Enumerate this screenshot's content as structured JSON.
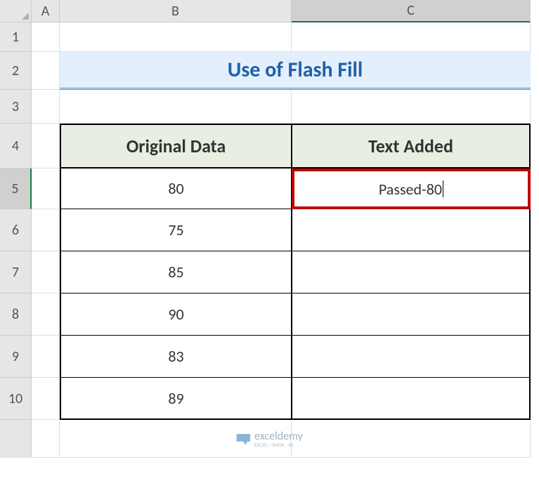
{
  "columns": {
    "A": "A",
    "B": "B",
    "C": "C"
  },
  "rows": [
    "1",
    "2",
    "3",
    "4",
    "5",
    "6",
    "7",
    "8",
    "9",
    "10"
  ],
  "title": "Use of Flash Fill",
  "headers": {
    "original": "Original Data",
    "added": "Text Added"
  },
  "data": [
    {
      "original": "80",
      "added": "Passed-80"
    },
    {
      "original": "75",
      "added": ""
    },
    {
      "original": "85",
      "added": ""
    },
    {
      "original": "90",
      "added": ""
    },
    {
      "original": "83",
      "added": ""
    },
    {
      "original": "89",
      "added": ""
    }
  ],
  "watermark": {
    "main": "exceldemy",
    "sub": "EXCEL · DATA · BI"
  }
}
